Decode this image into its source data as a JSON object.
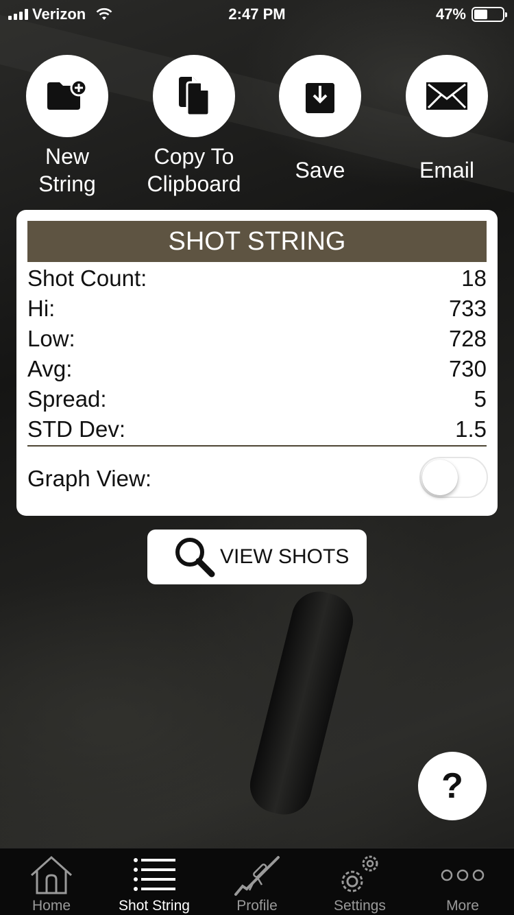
{
  "status_bar": {
    "carrier": "Verizon",
    "time": "2:47 PM",
    "battery_text": "47%",
    "battery_level": 0.47
  },
  "actions": [
    {
      "label_line1": "New",
      "label_line2": "String",
      "icon": "folder-add-icon"
    },
    {
      "label_line1": "Copy To",
      "label_line2": "Clipboard",
      "icon": "copy-icon"
    },
    {
      "label": "Save",
      "icon": "download-icon"
    },
    {
      "label": "Email",
      "icon": "envelope-icon"
    }
  ],
  "card": {
    "title": "SHOT STRING",
    "stats": [
      {
        "label": "Shot Count:",
        "value": "18"
      },
      {
        "label": "Hi:",
        "value": "733"
      },
      {
        "label": "Low:",
        "value": "728"
      },
      {
        "label": "Avg:",
        "value": "730"
      },
      {
        "label": "Spread:",
        "value": "5"
      },
      {
        "label": "STD Dev:",
        "value": "1.5"
      }
    ],
    "graph_view_label": "Graph View:",
    "graph_view_on": false
  },
  "view_shots": {
    "label": "VIEW SHOTS"
  },
  "help": {
    "label": "?"
  },
  "tabbar": {
    "tabs": [
      {
        "label": "Home",
        "icon": "home-icon"
      },
      {
        "label": "Shot String",
        "icon": "list-icon",
        "active": true
      },
      {
        "label": "Profile",
        "icon": "rifle-icon"
      },
      {
        "label": "Settings",
        "icon": "gears-icon"
      },
      {
        "label": "More",
        "icon": "more-icon"
      }
    ]
  },
  "colors": {
    "header": "#5e5442",
    "divider": "#4d4533"
  }
}
